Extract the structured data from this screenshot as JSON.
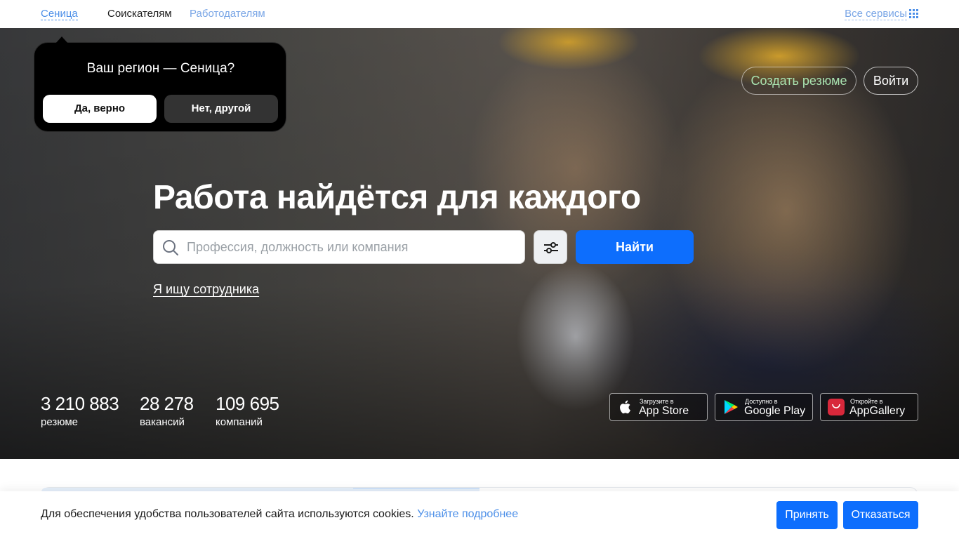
{
  "topnav": {
    "region": "Сеница",
    "seekers": "Соискателям",
    "employers": "Работодателям",
    "all_services": "Все сервисы",
    "all_services_icon": "grid-icon"
  },
  "region_popup": {
    "question": "Ваш регион — Сеница?",
    "yes_label": "Да, верно",
    "no_label": "Нет, другой"
  },
  "hero": {
    "create_resume": "Создать резюме",
    "login": "Войти",
    "headline": "Работа найдётся для каждого",
    "search": {
      "placeholder": "Профессия, должность или компания",
      "value": "",
      "icon": "search-icon",
      "filter_icon": "filter-icon"
    },
    "find_label": "Найти",
    "employer_link": "Я ищу сотрудника"
  },
  "stats": [
    {
      "value": "3 210 883",
      "label": "резюме"
    },
    {
      "value": "28 278",
      "label": "вакансий"
    },
    {
      "value": "109 695",
      "label": "компаний"
    }
  ],
  "stores": [
    {
      "small": "Загрузите в",
      "big": "App Store",
      "icon": "apple-icon"
    },
    {
      "small": "Доступно в",
      "big": "Google Play",
      "icon": "google-play-icon"
    },
    {
      "small": "Откройте в",
      "big": "AppGallery",
      "icon": "huawei-icon"
    }
  ],
  "cookie": {
    "text": "Для обеспечения удобства пользователей сайта используются cookies.",
    "more_link": "Узнайте подробнее",
    "accept": "Принять",
    "decline": "Отказаться"
  },
  "colors": {
    "accent": "#0d6efd",
    "link": "#4c8fe8",
    "resume_green": "#a9e3b0"
  }
}
